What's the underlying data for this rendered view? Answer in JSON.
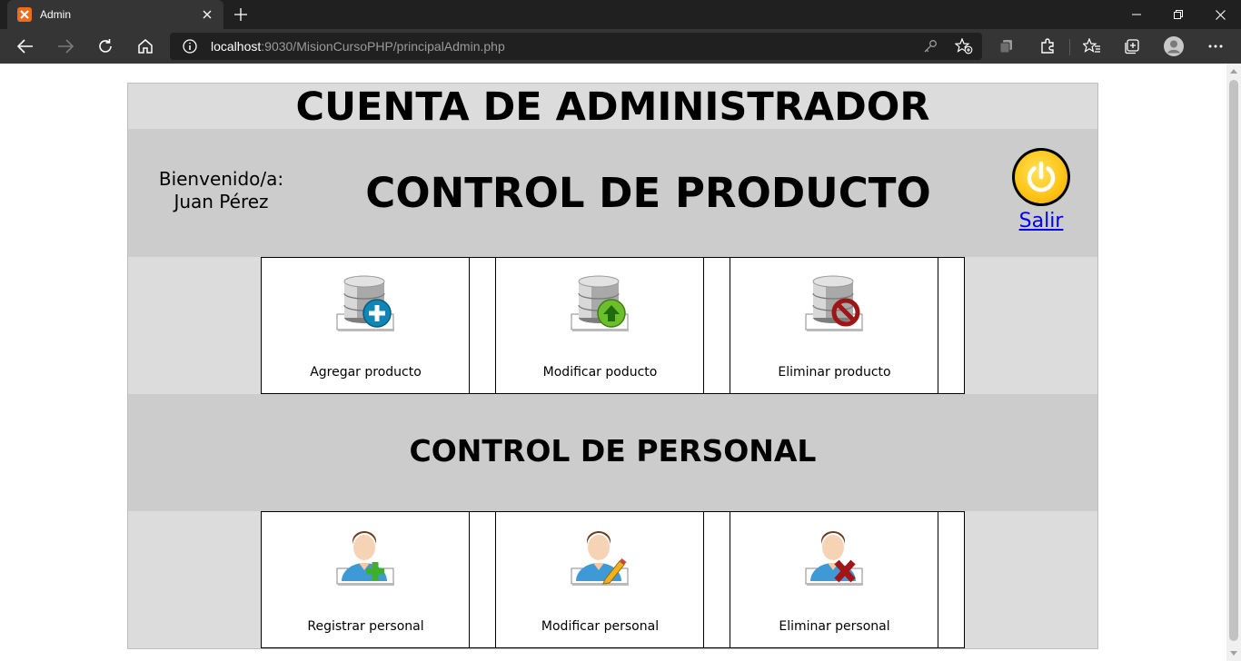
{
  "browser": {
    "tab_title": "Admin",
    "url_host": "localhost",
    "url_rest": ":9030/MisionCursoPHP/principalAdmin.php"
  },
  "page": {
    "title": "CUENTA DE ADMINISTRADOR",
    "welcome_line1": "Bienvenido/a:",
    "welcome_line2": "Juan Pérez",
    "product_title": "CONTROL DE PRODUCTO",
    "logout_label": "Salir",
    "personal_title": "CONTROL DE PERSONAL",
    "product_actions": [
      {
        "label": "Agregar producto",
        "icon": "database-add-icon"
      },
      {
        "label": "Modificar poducto",
        "icon": "database-update-icon"
      },
      {
        "label": "Eliminar producto",
        "icon": "database-delete-icon"
      }
    ],
    "personal_actions": [
      {
        "label": "Registrar personal",
        "icon": "user-add-icon"
      },
      {
        "label": "Modificar personal",
        "icon": "user-edit-icon"
      },
      {
        "label": "Eliminar personal",
        "icon": "user-delete-icon"
      }
    ]
  },
  "colors": {
    "title_band": "#dcdcdc",
    "section_band": "#cccccc",
    "link": "#0000ee",
    "power_button": "#ffc61a"
  }
}
